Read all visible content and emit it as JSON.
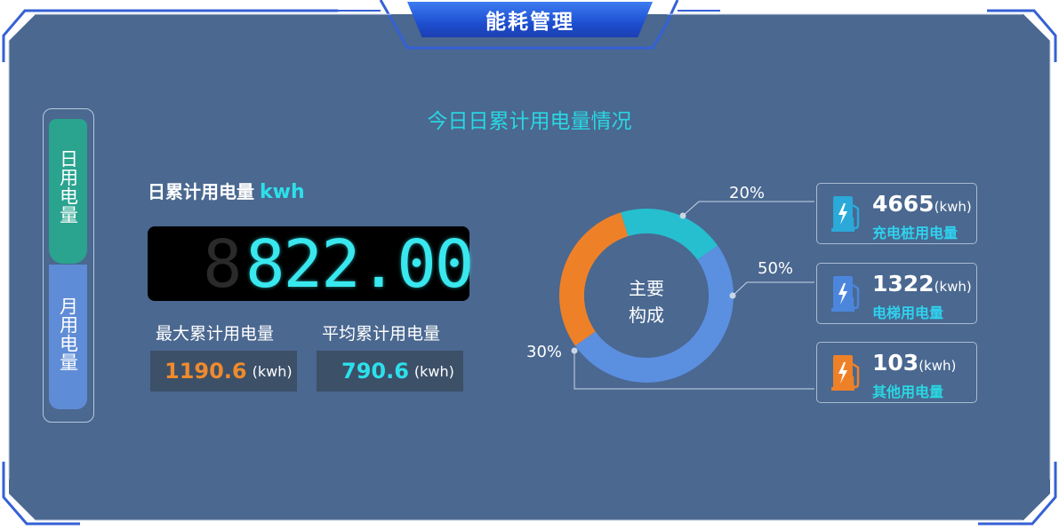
{
  "header": {
    "title": "能耗管理"
  },
  "side_tabs": [
    {
      "label": "日用电量"
    },
    {
      "label": "月用电量"
    }
  ],
  "section_title": "今日日累计用电量情况",
  "daily": {
    "label": "日累计用电量",
    "unit": "kwh",
    "display_value": "822.00"
  },
  "stats": {
    "max_label": "最大累计用电量",
    "max_value": "1190.6",
    "max_unit": "(kwh)",
    "avg_label": "平均累计用电量",
    "avg_value": "790.6",
    "avg_unit": "(kwh)"
  },
  "composition": {
    "center_line1": "主要",
    "center_line2": "构成",
    "pct_top": "20%",
    "pct_right": "50%",
    "pct_left": "30%"
  },
  "chart_data": {
    "type": "pie",
    "categories": [
      "",
      "",
      ""
    ],
    "values": [
      20,
      50,
      30
    ],
    "colors": [
      "#26bfcf",
      "#5b8fe0",
      "#ee8128"
    ]
  },
  "cards": [
    {
      "value": "4665",
      "unit": "(kwh)",
      "name": "充电桩用电量",
      "icon": "charger-icon",
      "color": "#2ba9d8"
    },
    {
      "value": "1322",
      "unit": "(kwh)",
      "name": "电梯用电量",
      "icon": "charger-icon",
      "color": "#4c86dc"
    },
    {
      "value": "103",
      "unit": "(kwh)",
      "name": "其他用电量",
      "icon": "charger-icon",
      "color": "#ee8128"
    }
  ],
  "colors": {
    "accent_cyan": "#29d7e2",
    "panel_bg": "#4a6890",
    "orange": "#ef8a2c",
    "teal_tab": "#2aa38f",
    "blue_tab": "#5f8cd6"
  }
}
